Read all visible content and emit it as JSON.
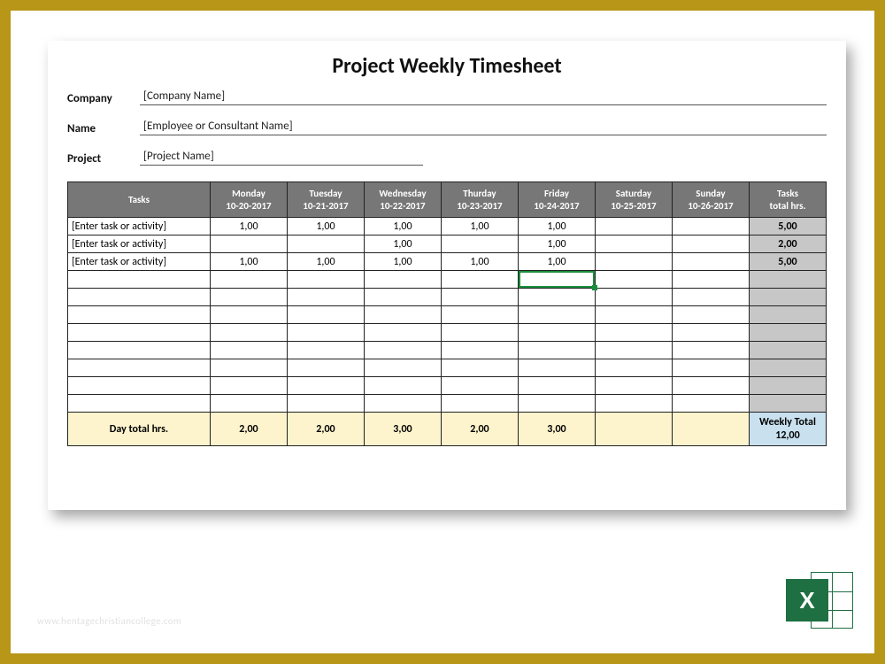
{
  "title": "Project Weekly Timesheet",
  "meta": {
    "company_label": "Company",
    "company_value": "[Company Name]",
    "name_label": "Name",
    "name_value": "[Employee or Consultant Name]",
    "project_label": "Project",
    "project_value": "[Project Name]"
  },
  "columns": {
    "tasks": "Tasks",
    "days": [
      {
        "name": "Monday",
        "date": "10-20-2017"
      },
      {
        "name": "Tuesday",
        "date": "10-21-2017"
      },
      {
        "name": "Wednesday",
        "date": "10-22-2017"
      },
      {
        "name": "Thurday",
        "date": "10-23-2017"
      },
      {
        "name": "Friday",
        "date": "10-24-2017"
      },
      {
        "name": "Saturday",
        "date": "10-25-2017"
      },
      {
        "name": "Sunday",
        "date": "10-26-2017"
      }
    ],
    "total": "Tasks\ntotal hrs."
  },
  "rows": [
    {
      "task": "[Enter task or activity]",
      "vals": [
        "1,00",
        "1,00",
        "1,00",
        "1,00",
        "1,00",
        "",
        ""
      ],
      "total": "5,00"
    },
    {
      "task": "[Enter task or activity]",
      "vals": [
        "",
        "",
        "1,00",
        "",
        "1,00",
        "",
        ""
      ],
      "total": "2,00"
    },
    {
      "task": "[Enter task or activity]",
      "vals": [
        "1,00",
        "1,00",
        "1,00",
        "1,00",
        "1,00",
        "",
        ""
      ],
      "total": "5,00"
    },
    {
      "task": "",
      "vals": [
        "",
        "",
        "",
        "",
        "",
        "",
        ""
      ],
      "total": ""
    },
    {
      "task": "",
      "vals": [
        "",
        "",
        "",
        "",
        "",
        "",
        ""
      ],
      "total": ""
    },
    {
      "task": "",
      "vals": [
        "",
        "",
        "",
        "",
        "",
        "",
        ""
      ],
      "total": ""
    },
    {
      "task": "",
      "vals": [
        "",
        "",
        "",
        "",
        "",
        "",
        ""
      ],
      "total": ""
    },
    {
      "task": "",
      "vals": [
        "",
        "",
        "",
        "",
        "",
        "",
        ""
      ],
      "total": ""
    },
    {
      "task": "",
      "vals": [
        "",
        "",
        "",
        "",
        "",
        "",
        ""
      ],
      "total": ""
    },
    {
      "task": "",
      "vals": [
        "",
        "",
        "",
        "",
        "",
        "",
        ""
      ],
      "total": ""
    },
    {
      "task": "",
      "vals": [
        "",
        "",
        "",
        "",
        "",
        "",
        ""
      ],
      "total": ""
    }
  ],
  "selected": {
    "row": 3,
    "col": 4
  },
  "day_totals": {
    "label": "Day total hrs.",
    "vals": [
      "2,00",
      "2,00",
      "3,00",
      "2,00",
      "3,00",
      "",
      ""
    ]
  },
  "weekly_total": {
    "label": "Weekly Total",
    "value": "12,00"
  },
  "watermark": "www.hentagechristiancollege.com",
  "badge_letter": "X"
}
